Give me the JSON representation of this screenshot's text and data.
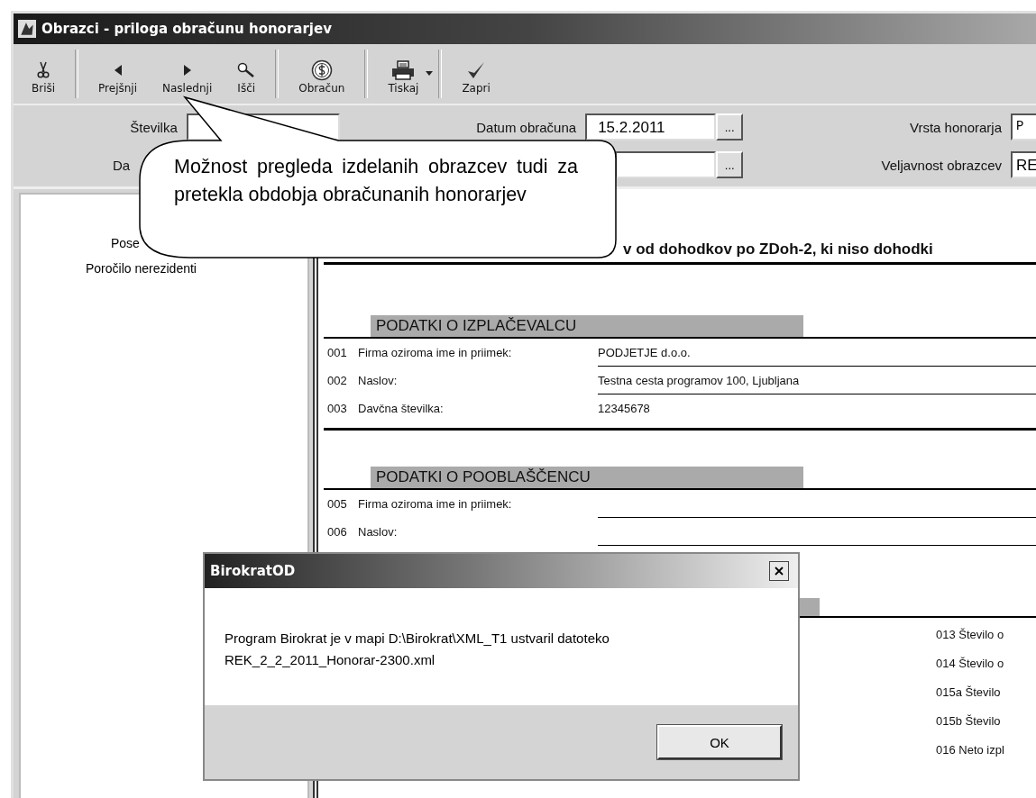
{
  "window": {
    "title": "Obrazci - priloga obračunu honorarjev"
  },
  "toolbar": [
    {
      "items": [
        {
          "label": "Briši",
          "kind": "scissors",
          "dropdown": false
        }
      ]
    },
    {
      "items": [
        {
          "label": "Prejšnji",
          "kind": "prev",
          "dropdown": false
        },
        {
          "label": "Naslednji",
          "kind": "next",
          "dropdown": false
        },
        {
          "label": "Išči",
          "kind": "search",
          "dropdown": false
        }
      ]
    },
    {
      "items": [
        {
          "label": "Obračun",
          "kind": "money",
          "dropdown": false
        }
      ]
    },
    {
      "items": [
        {
          "label": "Tiskaj",
          "kind": "printer",
          "dropdown": true
        }
      ]
    },
    {
      "items": [
        {
          "label": "Zapri",
          "kind": "check",
          "dropdown": false
        }
      ]
    }
  ],
  "form": {
    "rows": [
      [
        {
          "label": "Številka",
          "kind": "text"
        },
        {
          "label": "Datum obračuna",
          "value": "15.2.2011",
          "kind": "date",
          "picker": "..."
        },
        {
          "label": "Vrsta honorarja",
          "value": "P",
          "kind": "code"
        }
      ],
      [
        {
          "label": "Da",
          "kind": "label"
        },
        {
          "kind": "date",
          "picker": "..."
        },
        {
          "label": "Veljavnost obrazcev",
          "value": "RE",
          "kind": "text"
        }
      ]
    ]
  },
  "side_list": [
    "Pose",
    "Poročilo nerezidenti"
  ],
  "document": {
    "title": "v od dohodkov po ZDoh-2, ki niso dohodki",
    "sections": [
      {
        "heading": "PODATKI O IZPLAČEVALCU",
        "rows": [
          {
            "number": "001",
            "label": "Firma oziroma ime in priimek:",
            "value": "PODJETJE d.o.o."
          },
          {
            "number": "002",
            "label": "Naslov:",
            "value": "Testna cesta programov 100, Ljubljana"
          },
          {
            "number": "003",
            "label": "Davčna številka:",
            "value": "12345678"
          }
        ]
      },
      {
        "heading": "PODATKI O POOBLAŠČENCU",
        "rows": [
          {
            "number": "005",
            "label": "Firma oziroma ime in priimek:"
          },
          {
            "number": "006",
            "label": "Naslov:"
          }
        ]
      }
    ],
    "right_rows": [
      "013 Število o",
      "014 Število o",
      "015a Število",
      "015b Število",
      "016 Neto izpl"
    ]
  },
  "callout": {
    "text": "Možnost pregleda izdelanih obrazcev tudi za pretekla obdobja obračunanih honorarjev"
  },
  "dialog": {
    "title": "BirokratOD",
    "message": [
      "Program Birokrat je v mapi D:\\Birokrat\\XML_T1 ustvaril datoteko",
      "REK_2_2_2011_Honorar-2300.xml"
    ],
    "buttons": [
      "OK"
    ]
  }
}
